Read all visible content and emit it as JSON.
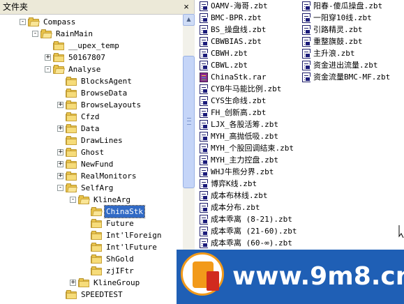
{
  "folder_pane": {
    "title": "文件夹",
    "close_glyph": "×"
  },
  "tree": [
    {
      "label": "Compass",
      "level": 0,
      "expander": "-",
      "open": true
    },
    {
      "label": "RainMain",
      "level": 1,
      "expander": "-",
      "open": true
    },
    {
      "label": "__upex_temp",
      "level": 2,
      "expander": "",
      "open": false
    },
    {
      "label": "50167807",
      "level": 2,
      "expander": "+",
      "open": false
    },
    {
      "label": "Analyse",
      "level": 2,
      "expander": "-",
      "open": true
    },
    {
      "label": "BlocksAgent",
      "level": 3,
      "expander": "",
      "open": false
    },
    {
      "label": "BrowseData",
      "level": 3,
      "expander": "",
      "open": false
    },
    {
      "label": "BrowseLayouts",
      "level": 3,
      "expander": "+",
      "open": false
    },
    {
      "label": "Cfzd",
      "level": 3,
      "expander": "",
      "open": false
    },
    {
      "label": "Data",
      "level": 3,
      "expander": "+",
      "open": false
    },
    {
      "label": "DrawLines",
      "level": 3,
      "expander": "",
      "open": false
    },
    {
      "label": "Ghost",
      "level": 3,
      "expander": "+",
      "open": false
    },
    {
      "label": "NewFund",
      "level": 3,
      "expander": "+",
      "open": false
    },
    {
      "label": "RealMonitors",
      "level": 3,
      "expander": "+",
      "open": false
    },
    {
      "label": "SelfArg",
      "level": 3,
      "expander": "-",
      "open": true
    },
    {
      "label": "KlineArg",
      "level": 4,
      "expander": "-",
      "open": true
    },
    {
      "label": "ChinaStk",
      "level": 5,
      "expander": "",
      "open": true,
      "selected": true
    },
    {
      "label": "Future",
      "level": 5,
      "expander": "",
      "open": false
    },
    {
      "label": "Int'lForeign",
      "level": 5,
      "expander": "",
      "open": false
    },
    {
      "label": "Int'lFuture",
      "level": 5,
      "expander": "",
      "open": false
    },
    {
      "label": "ShGold",
      "level": 5,
      "expander": "",
      "open": false
    },
    {
      "label": "zjIFtr",
      "level": 5,
      "expander": "",
      "open": false
    },
    {
      "label": "KlineGroup",
      "level": 4,
      "expander": "+",
      "open": false
    },
    {
      "label": "SPEEDTEST",
      "level": 3,
      "expander": "",
      "open": false
    }
  ],
  "scrollbar": {
    "up_glyph": "▲",
    "down_glyph": "▼"
  },
  "files": {
    "column1": [
      {
        "name": "OAMV-海哥.zbt",
        "icon": "zbt-file-icon"
      },
      {
        "name": "BMC-BPR.zbt",
        "icon": "zbt-file-icon"
      },
      {
        "name": "BS_操盘线.zbt",
        "icon": "zbt-file-icon"
      },
      {
        "name": "CBWBIAS.zbt",
        "icon": "zbt-file-icon"
      },
      {
        "name": "CBWH.zbt",
        "icon": "zbt-file-icon"
      },
      {
        "name": "CBWL.zbt",
        "icon": "zbt-file-icon"
      },
      {
        "name": "ChinaStk.rar",
        "icon": "rar-file-icon"
      },
      {
        "name": "CYB牛马能比例.zbt",
        "icon": "zbt-file-icon"
      },
      {
        "name": "CYS生命线.zbt",
        "icon": "zbt-file-icon"
      },
      {
        "name": "FH_创新高.zbt",
        "icon": "zbt-file-icon"
      },
      {
        "name": "LJX_各股活筹.zbt",
        "icon": "zbt-file-icon"
      },
      {
        "name": "MYH_高抛低吸.zbt",
        "icon": "zbt-file-icon"
      },
      {
        "name": "MYH_个股回调结束.zbt",
        "icon": "zbt-file-icon"
      },
      {
        "name": "MYH_主力控盘.zbt",
        "icon": "zbt-file-icon"
      },
      {
        "name": "WHJ牛熊分界.zbt",
        "icon": "zbt-file-icon"
      },
      {
        "name": "博弈K线.zbt",
        "icon": "zbt-file-icon"
      },
      {
        "name": "成本布林线.zbt",
        "icon": "zbt-file-icon"
      },
      {
        "name": "成本分布.zbt",
        "icon": "zbt-file-icon"
      },
      {
        "name": "成本乖离 (8-21).zbt",
        "icon": "zbt-file-icon"
      },
      {
        "name": "成本乖离 (21-60).zbt",
        "icon": "zbt-file-icon"
      },
      {
        "name": "成本乖离 (60-∞).zbt",
        "icon": "zbt-file-icon"
      }
    ],
    "column2": [
      {
        "name": "阳春-傻瓜操盘.zbt",
        "icon": "zbt-file-icon"
      },
      {
        "name": "一阳穿10线.zbt",
        "icon": "zbt-file-icon"
      },
      {
        "name": "引路精灵.zbt",
        "icon": "zbt-file-icon"
      },
      {
        "name": "重整旗鼓.zbt",
        "icon": "zbt-file-icon"
      },
      {
        "name": "主升浪.zbt",
        "icon": "zbt-file-icon"
      },
      {
        "name": "资金进出流量.zbt",
        "icon": "zbt-file-icon"
      },
      {
        "name": "资金流量BMC-MF.zbt",
        "icon": "zbt-file-icon"
      }
    ]
  },
  "watermark": {
    "text": "www.9m8.cn",
    "colors": {
      "background": "#1f5fb5",
      "ring": "#f29a1a",
      "mark": "#d12b1e"
    }
  },
  "colors": {
    "selection": "#316ac5",
    "folder": "#e8c24a",
    "header": "#ece9d8"
  }
}
